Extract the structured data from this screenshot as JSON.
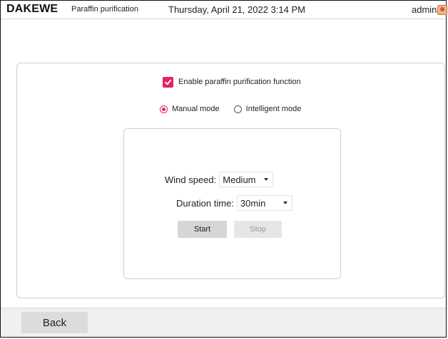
{
  "header": {
    "logo": "DAKEWE",
    "page_name": "Paraffin purification",
    "datetime": "Thursday, April 21, 2022  3:14 PM",
    "user": "admin",
    "avatar_icon": "user-avatar-icon"
  },
  "settings": {
    "enable_label": "Enable paraffin purification function",
    "enabled": true,
    "modes": [
      {
        "label": "Manual mode",
        "selected": true
      },
      {
        "label": "Intelligent mode",
        "selected": false
      }
    ]
  },
  "controls": {
    "wind_speed": {
      "label": "Wind speed:",
      "value": "Medium"
    },
    "duration": {
      "label": "Duration time:",
      "value": "30min"
    },
    "start_label": "Start",
    "stop_label": "Stop"
  },
  "footer": {
    "back_label": "Back"
  },
  "colors": {
    "accent": "#e1245c"
  }
}
